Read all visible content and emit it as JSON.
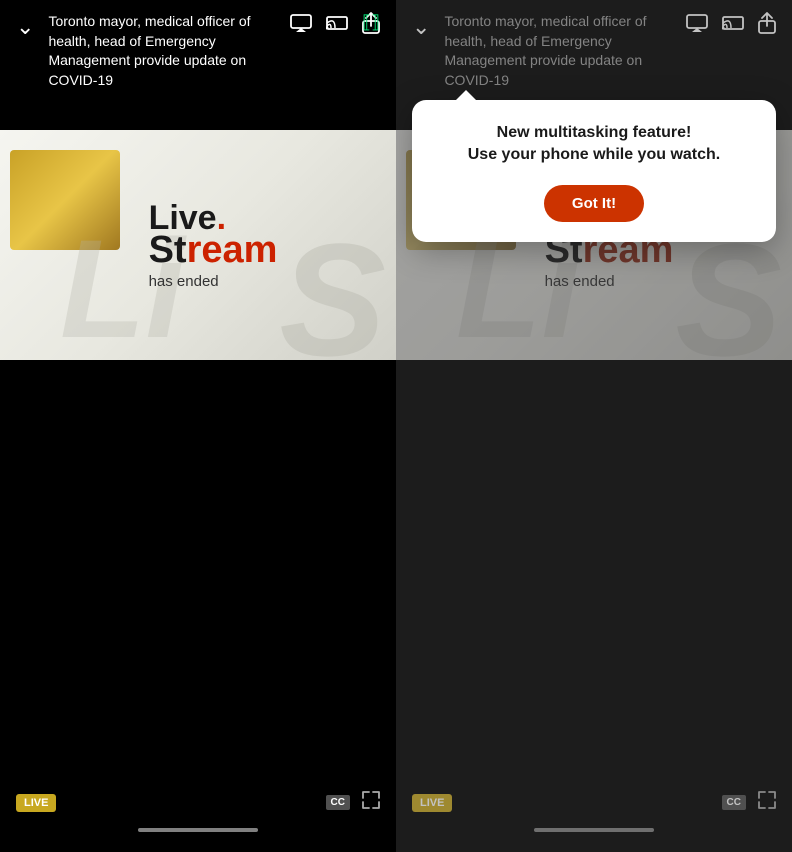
{
  "left_panel": {
    "green_indicator": "⬛",
    "chevron": "∨",
    "title": "Toronto mayor, medical officer of health, head of Emergency Management provide update on COVID-19",
    "icons": {
      "airplay": "⬜",
      "cast": "▭",
      "share": "⬆"
    },
    "video": {
      "logo_live": "Live",
      "logo_dot": ".",
      "logo_stream": "Stream",
      "logo_hasended": "has ended",
      "bg_letter": "S",
      "bg_letter_left": "Li"
    },
    "bottom": {
      "live_badge": "LIVE",
      "cc_badge": "CC"
    }
  },
  "right_panel": {
    "green_indicator": "⬛",
    "chevron": "∨",
    "title": "Toronto mayor, medical officer of health, head of Emergency Management provide update on COVID-19",
    "icons": {
      "airplay": "⬜",
      "cast": "▭",
      "share": "⬆"
    },
    "popup": {
      "message_line1": "New multitasking feature!",
      "message_line2": "Use your phone while you watch.",
      "button_label": "Got It!"
    },
    "bottom": {
      "live_badge": "LIVE",
      "cc_badge": "CC"
    }
  }
}
